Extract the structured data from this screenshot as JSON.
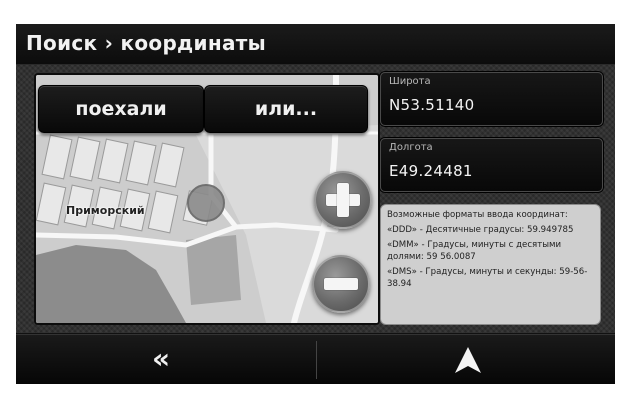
{
  "header": {
    "title": "Поиск › координаты"
  },
  "map": {
    "place_label": "Приморский",
    "buttons": {
      "go_label": "поехали",
      "or_label": "или..."
    },
    "zoom_in_icon": "plus-icon",
    "zoom_out_icon": "minus-icon"
  },
  "latitude": {
    "label": "Широта",
    "value": "N53.51140"
  },
  "longitude": {
    "label": "Долгота",
    "value": "E49.24481"
  },
  "formats": {
    "heading": "Возможные форматы ввода координат:",
    "ddd": "«DDD» - Десятичные градусы: 59.949785",
    "dmm": "«DMM» - Градусы, минуты с десятыми долями: 59 56.0087",
    "dms": "«DMS» - Градусы, минуты и секунды: 59-56-38.94"
  },
  "bottom_bar": {
    "back_glyph": "«",
    "back_icon": "double-chevron-left-icon",
    "navigate_icon": "navigation-arrow-icon"
  },
  "colors": {
    "header_bg": "#111111",
    "text_light": "#f2f2f2",
    "map_land": "#cfcfcf",
    "info_bg": "#cfcfcf"
  }
}
